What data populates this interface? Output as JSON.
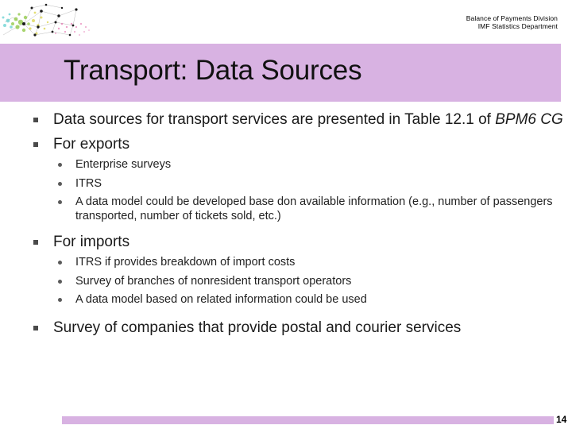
{
  "header": {
    "org_line_1": "Balance of Payments Division",
    "org_line_2": "IMF Statistics Department",
    "logo_name": "network-burst-logo"
  },
  "title": {
    "text": "Transport: Data Sources",
    "band_color": "#d8b2e2"
  },
  "content": {
    "bullet_1": {
      "text_before_italic": "Data sources for transport services are presented in Table 12.1 of ",
      "italic_text": "BPM6 CG"
    },
    "bullet_2": {
      "text": "For exports",
      "sub_bullets": [
        "Enterprise surveys",
        "ITRS",
        "A data model could be developed base don available information (e.g., number of passengers transported, number of tickets sold, etc.)"
      ]
    },
    "bullet_3": {
      "text": "For imports",
      "sub_bullets": [
        "ITRS if provides breakdown of import costs",
        "Survey of branches of nonresident transport operators",
        "A data model based on related information could be used"
      ]
    },
    "bullet_4": {
      "text": "Survey of companies that provide postal and courier services"
    }
  },
  "footer": {
    "page_number": "14",
    "bar_color": "#d8b2e2"
  }
}
